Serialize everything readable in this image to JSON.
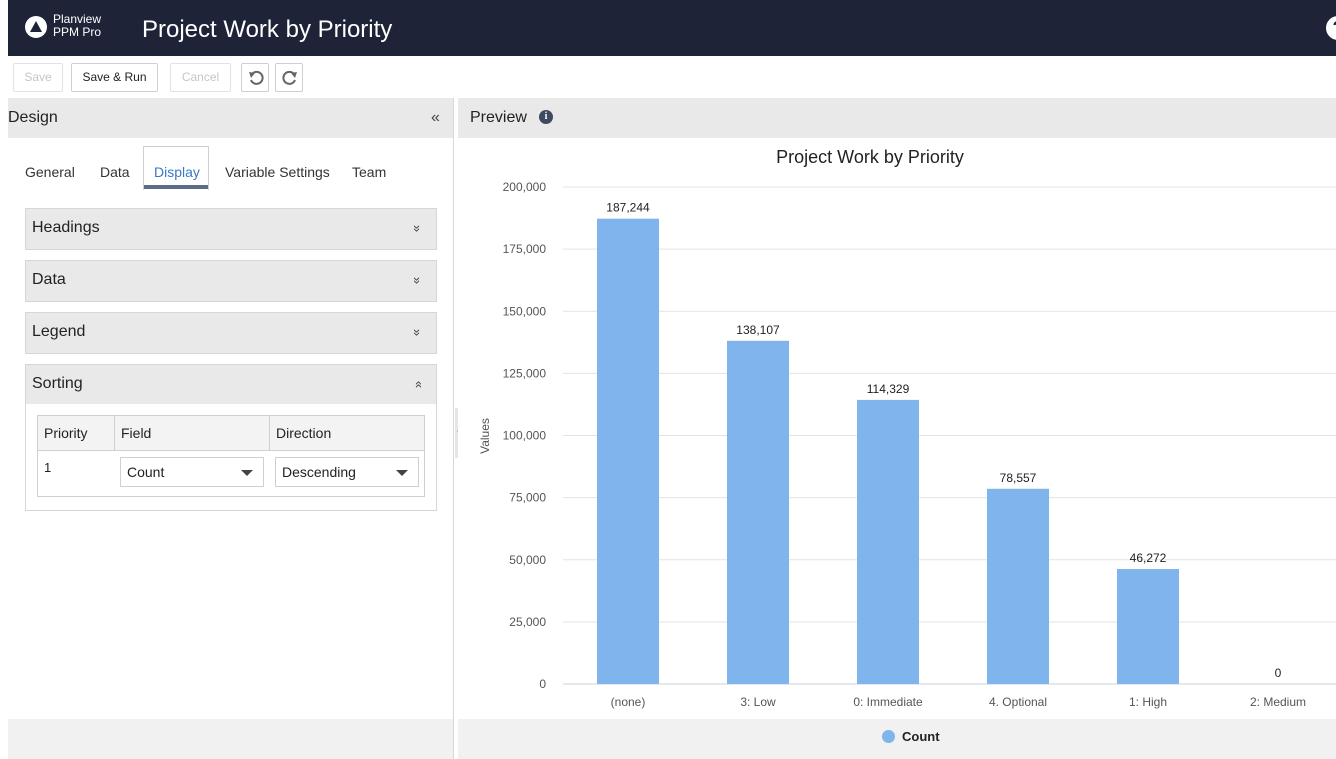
{
  "header": {
    "brand_line1": "Planview",
    "brand_line2": "PPM Pro",
    "title": "Project Work by Priority",
    "help_icon": "?"
  },
  "toolbar": {
    "save_label": "Save",
    "save_run_label": "Save & Run",
    "cancel_label": "Cancel",
    "undo_icon": "undo-icon",
    "redo_icon": "redo-icon"
  },
  "design": {
    "title": "Design",
    "collapse_glyph": "«",
    "tabs": [
      {
        "label": "General"
      },
      {
        "label": "Data"
      },
      {
        "label": "Display"
      },
      {
        "label": "Variable Settings"
      },
      {
        "label": "Team"
      }
    ],
    "active_tab": "Display",
    "sections": [
      {
        "label": "Headings",
        "chevron": "»"
      },
      {
        "label": "Data",
        "chevron": "»"
      },
      {
        "label": "Legend",
        "chevron": "»"
      },
      {
        "label": "Sorting",
        "chevron": "»"
      }
    ],
    "sorting": {
      "headers": [
        "Priority",
        "Field",
        "Direction"
      ],
      "rows": [
        {
          "priority": "1",
          "field": "Count",
          "direction": "Descending"
        }
      ]
    }
  },
  "preview": {
    "title": "Preview",
    "info_icon": "i"
  },
  "chart_data": {
    "type": "bar",
    "title": "Project Work by Priority",
    "xlabel": "",
    "ylabel": "Values",
    "categories": [
      "(none)",
      "3: Low",
      "0: Immediate",
      "4. Optional",
      "1: High",
      "2: Medium"
    ],
    "series": [
      {
        "name": "Count",
        "values": [
          187244,
          138107,
          114329,
          78557,
          46272,
          0
        ],
        "color": "#7fb5ec"
      }
    ],
    "data_labels": [
      "187,244",
      "138,107",
      "114,329",
      "78,557",
      "46,272",
      "0"
    ],
    "ylim": [
      0,
      200000
    ],
    "yticks": [
      0,
      25000,
      50000,
      75000,
      100000,
      125000,
      150000,
      175000,
      200000
    ],
    "ytick_labels": [
      "0",
      "25,000",
      "50,000",
      "75,000",
      "100,000",
      "125,000",
      "150,000",
      "175,000",
      "200,000"
    ],
    "grid": true,
    "legend": "bottom"
  }
}
